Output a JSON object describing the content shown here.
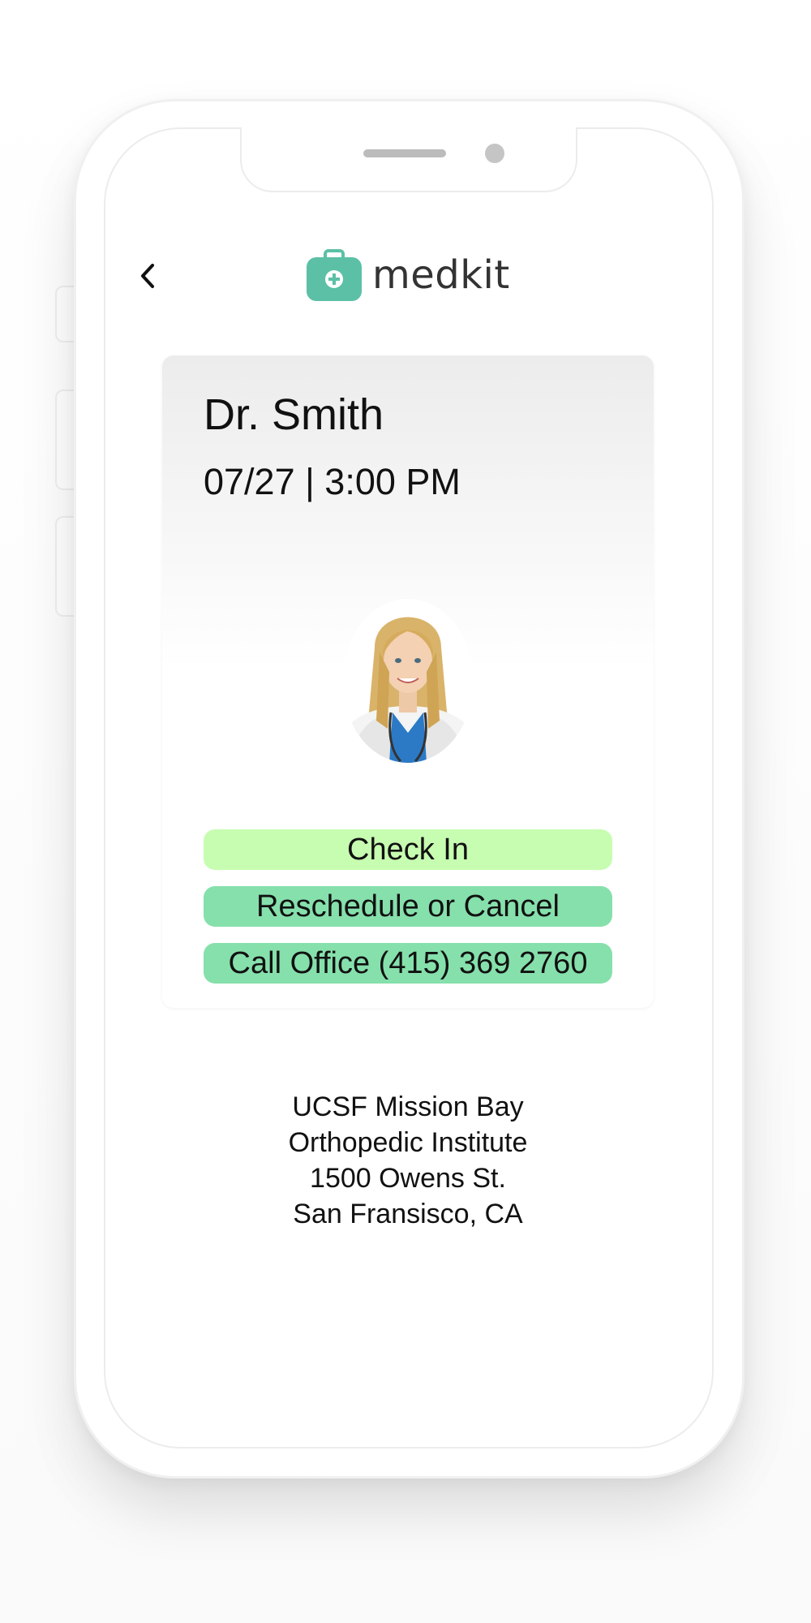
{
  "app": {
    "name": "medkit",
    "accent_color": "#5cc0a6"
  },
  "header": {
    "back_icon": "chevron-left-icon",
    "logo_icon": "medical-kit-icon"
  },
  "appointment": {
    "doctor": "Dr. Smith",
    "datetime": "07/27 | 3:00 PM",
    "avatar_icon": "doctor-avatar"
  },
  "actions": {
    "check_in": {
      "label": "Check In",
      "color": "#c7fdb1"
    },
    "reschedule": {
      "label": "Reschedule or Cancel",
      "color": "#86e0ac"
    },
    "call_office": {
      "label": "Call Office (415) 369 2760",
      "color": "#86e0ac"
    }
  },
  "location": {
    "lines": [
      "UCSF Mission Bay",
      "Orthopedic Institute",
      "1500 Owens St.",
      "San Fransisco, CA"
    ]
  }
}
